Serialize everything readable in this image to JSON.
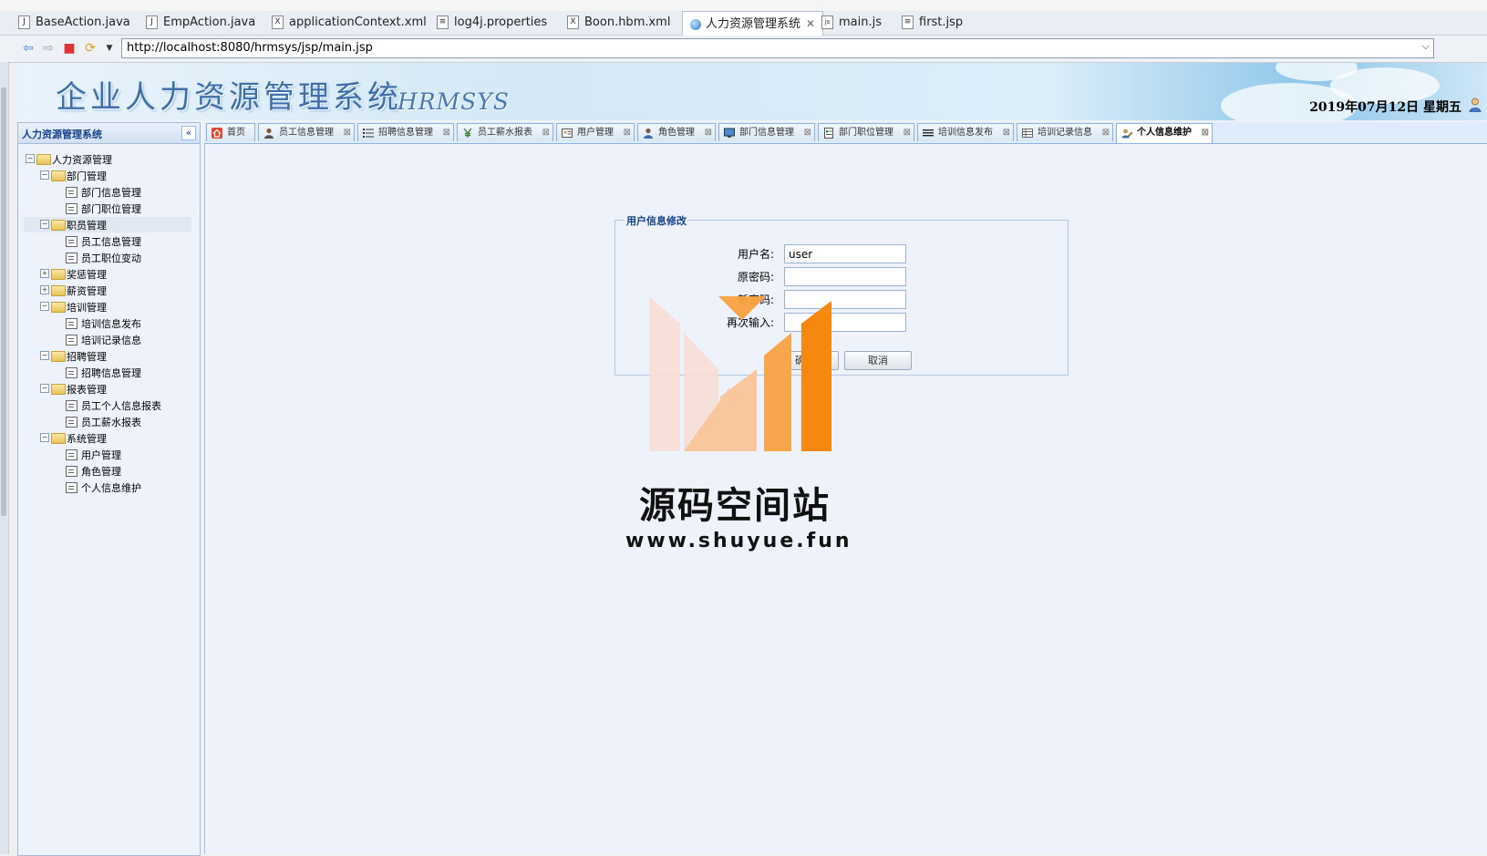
{
  "editor_tabs": [
    {
      "label": "BaseAction.java",
      "icon": "J"
    },
    {
      "label": "EmpAction.java",
      "icon": "J"
    },
    {
      "label": "applicationContext.xml",
      "icon": "X"
    },
    {
      "label": "log4j.properties",
      "icon": "≡"
    },
    {
      "label": "Boon.hbm.xml",
      "icon": "X"
    },
    {
      "label": "人力资源管理系统",
      "icon": "globe",
      "active": true
    },
    {
      "label": "main.js",
      "icon": "js"
    },
    {
      "label": "first.jsp",
      "icon": "≡"
    }
  ],
  "browser": {
    "url": "http://localhost:8080/hrmsys/jsp/main.jsp"
  },
  "banner": {
    "title": "企业人力资源管理系统",
    "subtitle": "HRMSYS",
    "date": "2019年07月12日 星期五"
  },
  "nav": {
    "header": "人力资源管理系统",
    "collapse_glyph": "«",
    "tree": [
      {
        "label": "人力资源管理",
        "level": 0,
        "type": "folder",
        "toggle": "−"
      },
      {
        "label": "部门管理",
        "level": 1,
        "type": "folder",
        "toggle": "−"
      },
      {
        "label": "部门信息管理",
        "level": 2,
        "type": "leaf"
      },
      {
        "label": "部门职位管理",
        "level": 2,
        "type": "leaf"
      },
      {
        "label": "职员管理",
        "level": 1,
        "type": "folder",
        "toggle": "−",
        "selected": true
      },
      {
        "label": "员工信息管理",
        "level": 2,
        "type": "leaf"
      },
      {
        "label": "员工职位变动",
        "level": 2,
        "type": "leaf"
      },
      {
        "label": "奖惩管理",
        "level": 1,
        "type": "folder",
        "toggle": "+"
      },
      {
        "label": "薪资管理",
        "level": 1,
        "type": "folder",
        "toggle": "+"
      },
      {
        "label": "培训管理",
        "level": 1,
        "type": "folder",
        "toggle": "−"
      },
      {
        "label": "培训信息发布",
        "level": 2,
        "type": "leaf"
      },
      {
        "label": "培训记录信息",
        "level": 2,
        "type": "leaf"
      },
      {
        "label": "招聘管理",
        "level": 1,
        "type": "folder",
        "toggle": "−"
      },
      {
        "label": "招聘信息管理",
        "level": 2,
        "type": "leaf"
      },
      {
        "label": "报表管理",
        "level": 1,
        "type": "folder",
        "toggle": "−"
      },
      {
        "label": "员工个人信息报表",
        "level": 2,
        "type": "leaf"
      },
      {
        "label": "员工薪水报表",
        "level": 2,
        "type": "leaf"
      },
      {
        "label": "系统管理",
        "level": 1,
        "type": "folder",
        "toggle": "−"
      },
      {
        "label": "用户管理",
        "level": 2,
        "type": "leaf"
      },
      {
        "label": "角色管理",
        "level": 2,
        "type": "leaf"
      },
      {
        "label": "个人信息维护",
        "level": 2,
        "type": "leaf"
      }
    ]
  },
  "tabs": [
    {
      "label": "首页",
      "icon": "home-icon",
      "closable": false
    },
    {
      "label": "员工信息管理",
      "icon": "person-icon",
      "closable": true
    },
    {
      "label": "招聘信息管理",
      "icon": "list-icon",
      "closable": true
    },
    {
      "label": "员工薪水报表",
      "icon": "yen-icon",
      "closable": true
    },
    {
      "label": "用户管理",
      "icon": "user-card-icon",
      "closable": true
    },
    {
      "label": "角色管理",
      "icon": "person-icon",
      "closable": true
    },
    {
      "label": "部门信息管理",
      "icon": "monitor-icon",
      "closable": true
    },
    {
      "label": "部门职位管理",
      "icon": "document-icon",
      "closable": true
    },
    {
      "label": "培训信息发布",
      "icon": "text-icon",
      "closable": true
    },
    {
      "label": "培训记录信息",
      "icon": "table-icon",
      "closable": true
    },
    {
      "label": "个人信息维护",
      "icon": "edit-user-icon",
      "closable": true,
      "active": true
    }
  ],
  "form": {
    "legend": "用户信息修改",
    "fields": [
      {
        "label": "用户名:",
        "value": "user"
      },
      {
        "label": "原密码:",
        "value": ""
      },
      {
        "label": "新密码:",
        "value": ""
      },
      {
        "label": "再次输入:",
        "value": ""
      }
    ],
    "ok_label": "确定",
    "cancel_label": "取消"
  },
  "watermark": {
    "title": "源码空间站",
    "url": "www.shuyue.fun",
    "colors": [
      "#f7ddd6",
      "#f9c79e",
      "#f8a64d",
      "#f6870f"
    ]
  }
}
